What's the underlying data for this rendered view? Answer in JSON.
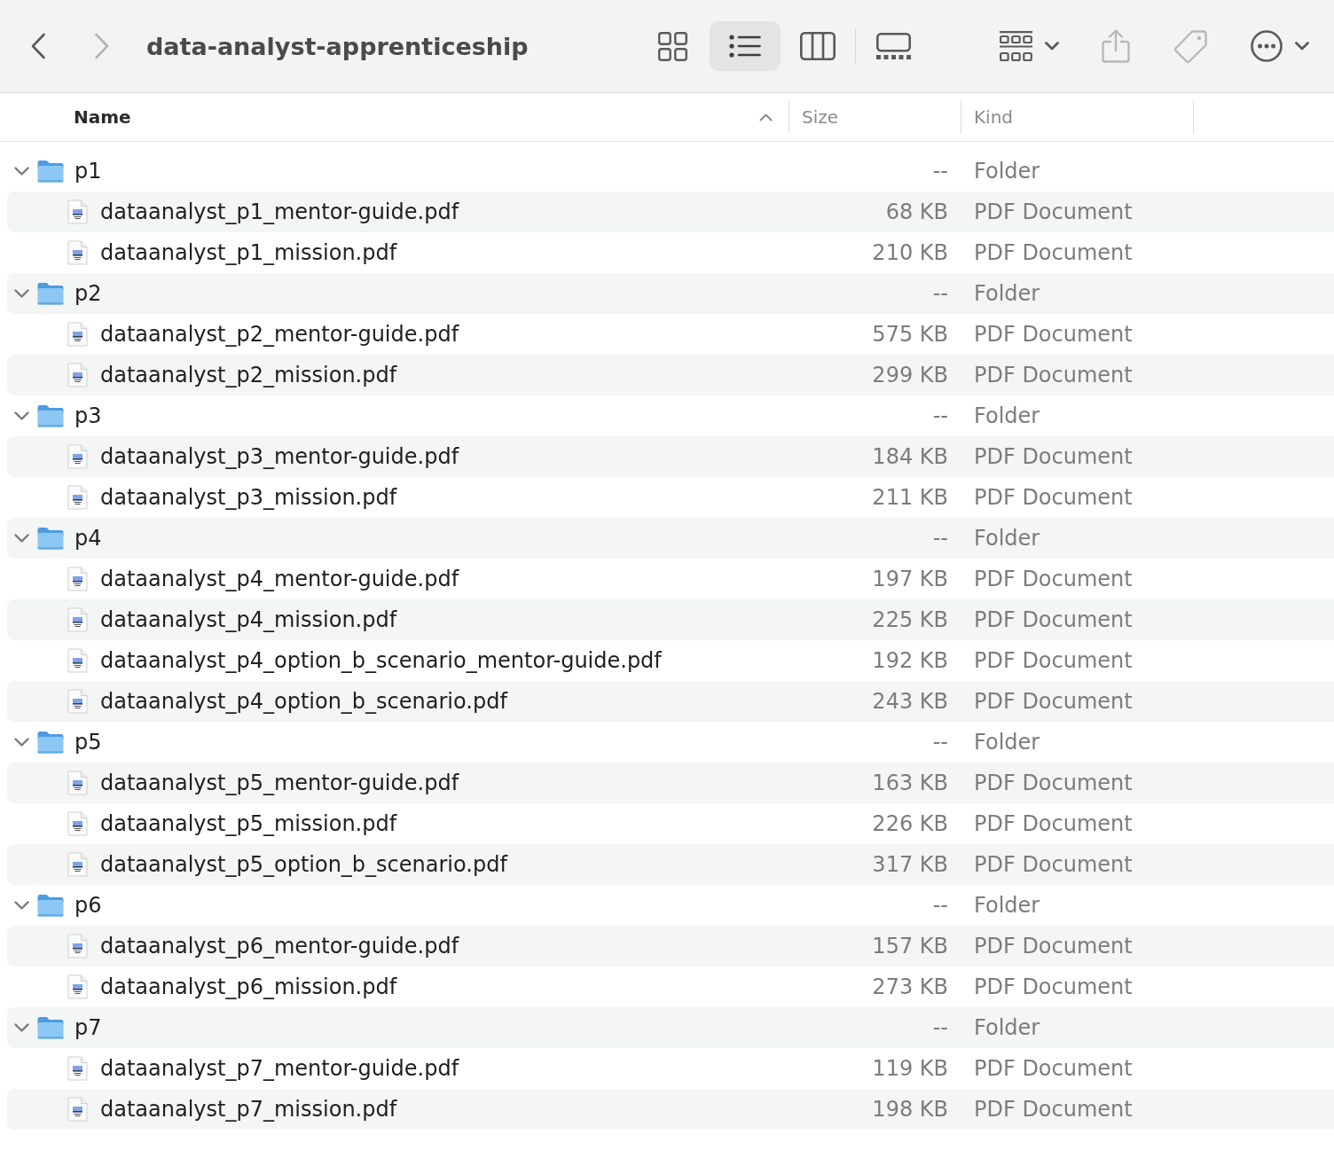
{
  "toolbar": {
    "navigation": [
      {
        "kind": "back",
        "disabled": false
      },
      {
        "kind": "forward",
        "disabled": true
      }
    ],
    "title": "data-analyst-apprenticeship",
    "views": [
      {
        "kind": "icons",
        "selected": false
      },
      {
        "kind": "list",
        "selected": true
      },
      {
        "kind": "columns",
        "selected": false
      },
      {
        "kind": "gallery",
        "selected": false
      }
    ],
    "actions": [
      {
        "kind": "group",
        "disabled": false,
        "menu": true
      },
      {
        "kind": "share",
        "disabled": true,
        "menu": false
      },
      {
        "kind": "tags",
        "disabled": true,
        "menu": false
      },
      {
        "kind": "more",
        "disabled": false,
        "menu": true
      }
    ]
  },
  "table": {
    "columns": [
      {
        "label": "Name",
        "sorted": true
      },
      {
        "label": "Size",
        "sorted": false
      },
      {
        "label": "Kind",
        "sorted": false
      }
    ],
    "items": [
      {
        "kind": "folder",
        "name": "p1",
        "size": "--",
        "kind_label": "Folder",
        "expanded": true,
        "children": [
          {
            "kind": "document",
            "name": "dataanalyst_p1_mentor-guide.pdf",
            "size": "68 KB",
            "kind_label": "PDF Document"
          },
          {
            "kind": "document",
            "name": "dataanalyst_p1_mission.pdf",
            "size": "210 KB",
            "kind_label": "PDF Document"
          }
        ]
      },
      {
        "kind": "folder",
        "name": "p2",
        "size": "--",
        "kind_label": "Folder",
        "expanded": true,
        "children": [
          {
            "kind": "document",
            "name": "dataanalyst_p2_mentor-guide.pdf",
            "size": "575 KB",
            "kind_label": "PDF Document"
          },
          {
            "kind": "document",
            "name": "dataanalyst_p2_mission.pdf",
            "size": "299 KB",
            "kind_label": "PDF Document"
          }
        ]
      },
      {
        "kind": "folder",
        "name": "p3",
        "size": "--",
        "kind_label": "Folder",
        "expanded": true,
        "children": [
          {
            "kind": "document",
            "name": "dataanalyst_p3_mentor-guide.pdf",
            "size": "184 KB",
            "kind_label": "PDF Document"
          },
          {
            "kind": "document",
            "name": "dataanalyst_p3_mission.pdf",
            "size": "211 KB",
            "kind_label": "PDF Document"
          }
        ]
      },
      {
        "kind": "folder",
        "name": "p4",
        "size": "--",
        "kind_label": "Folder",
        "expanded": true,
        "children": [
          {
            "kind": "document",
            "name": "dataanalyst_p4_mentor-guide.pdf",
            "size": "197 KB",
            "kind_label": "PDF Document"
          },
          {
            "kind": "document",
            "name": "dataanalyst_p4_mission.pdf",
            "size": "225 KB",
            "kind_label": "PDF Document"
          },
          {
            "kind": "document",
            "name": "dataanalyst_p4_option_b_scenario_mentor-guide.pdf",
            "size": "192 KB",
            "kind_label": "PDF Document"
          },
          {
            "kind": "document",
            "name": "dataanalyst_p4_option_b_scenario.pdf",
            "size": "243 KB",
            "kind_label": "PDF Document"
          }
        ]
      },
      {
        "kind": "folder",
        "name": "p5",
        "size": "--",
        "kind_label": "Folder",
        "expanded": true,
        "children": [
          {
            "kind": "document",
            "name": "dataanalyst_p5_mentor-guide.pdf",
            "size": "163 KB",
            "kind_label": "PDF Document"
          },
          {
            "kind": "document",
            "name": "dataanalyst_p5_mission.pdf",
            "size": "226 KB",
            "kind_label": "PDF Document"
          },
          {
            "kind": "document",
            "name": "dataanalyst_p5_option_b_scenario.pdf",
            "size": "317 KB",
            "kind_label": "PDF Document"
          }
        ]
      },
      {
        "kind": "folder",
        "name": "p6",
        "size": "--",
        "kind_label": "Folder",
        "expanded": true,
        "children": [
          {
            "kind": "document",
            "name": "dataanalyst_p6_mentor-guide.pdf",
            "size": "157 KB",
            "kind_label": "PDF Document"
          },
          {
            "kind": "document",
            "name": "dataanalyst_p6_mission.pdf",
            "size": "273 KB",
            "kind_label": "PDF Document"
          }
        ]
      },
      {
        "kind": "folder",
        "name": "p7",
        "size": "--",
        "kind_label": "Folder",
        "expanded": true,
        "children": [
          {
            "kind": "document",
            "name": "dataanalyst_p7_mentor-guide.pdf",
            "size": "119 KB",
            "kind_label": "PDF Document"
          },
          {
            "kind": "document",
            "name": "dataanalyst_p7_mission.pdf",
            "size": "198 KB",
            "kind_label": "PDF Document"
          }
        ]
      }
    ]
  }
}
